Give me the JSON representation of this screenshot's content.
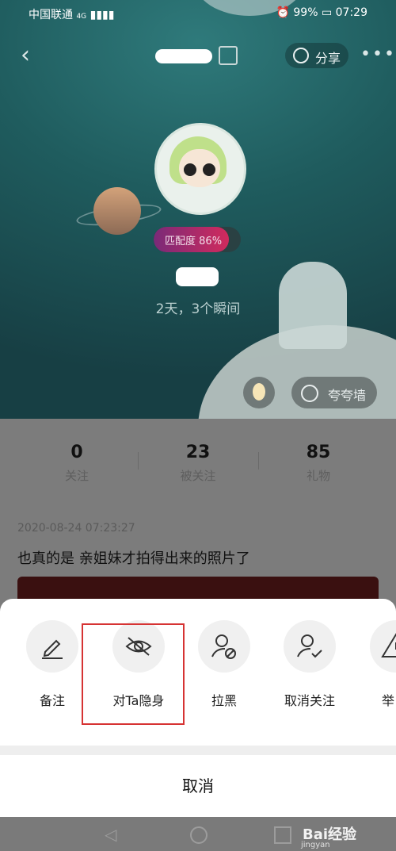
{
  "status_bar": {
    "carrier": "中国联通",
    "signal": "4G",
    "battery": "99%",
    "time": "07:29"
  },
  "header": {
    "share_label": "分享",
    "more_label": "•••"
  },
  "profile": {
    "match_label": "匹配度",
    "match_value": "86%",
    "match_fraction": 0.86,
    "moments": "2天，3个瞬间",
    "praise_wall": "夸夸墙"
  },
  "stats": [
    {
      "value": "0",
      "label": "关注"
    },
    {
      "value": "23",
      "label": "被关注"
    },
    {
      "value": "85",
      "label": "礼物"
    }
  ],
  "post": {
    "date": "2020-08-24 07:23:27",
    "text": "也真的是 亲姐妹才拍得出来的照片了"
  },
  "sheet": {
    "actions": [
      {
        "label": "备注",
        "icon": "pencil-icon"
      },
      {
        "label": "对Ta隐身",
        "icon": "eye-off-icon"
      },
      {
        "label": "拉黑",
        "icon": "user-block-icon"
      },
      {
        "label": "取消关注",
        "icon": "user-check-icon"
      },
      {
        "label": "举",
        "icon": "warning-icon"
      }
    ],
    "cancel": "取消"
  },
  "watermark": {
    "logo": "Bai经验",
    "url": "jingyan"
  }
}
